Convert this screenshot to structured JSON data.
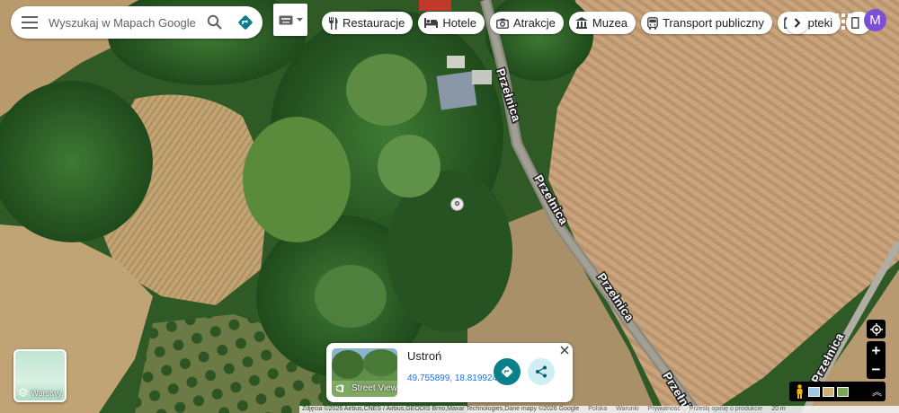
{
  "search": {
    "placeholder": "Wyszukaj w Mapach Google"
  },
  "icons": {
    "menu": "menu-icon",
    "search": "search-icon",
    "directions": "directions-icon",
    "keyboard": "keyboard-icon",
    "apps": "apps-grid-icon",
    "layers": "layers-icon",
    "street_view": "street-view-icon",
    "share": "share-icon",
    "close": "close-icon",
    "locate": "my-location-icon",
    "pegman": "pegman-icon"
  },
  "chips": [
    {
      "label": "Restauracje",
      "icon": "fork-knife-icon"
    },
    {
      "label": "Hotele",
      "icon": "bed-icon"
    },
    {
      "label": "Atrakcje",
      "icon": "camera-icon"
    },
    {
      "label": "Muzea",
      "icon": "museum-icon"
    },
    {
      "label": "Transport publiczny",
      "icon": "bus-icon"
    },
    {
      "label": "Apteki",
      "icon": "pharmacy-icon"
    }
  ],
  "account": {
    "initial": "M"
  },
  "map": {
    "road_labels": [
      "Przełnica",
      "Przełnica",
      "Przełnica",
      "Przełnica",
      "Przełnica"
    ]
  },
  "layers": {
    "label": "Warstwy"
  },
  "place_card": {
    "title": "Ustroń",
    "coordinates": "49.755899, 18.819924",
    "street_view_label": "Street View"
  },
  "controls": {
    "zoom_in": "+",
    "zoom_out": "−"
  },
  "footer": {
    "attribution": "Zdjęcia ©2026 Airbus,CNES / Airbus,GEODIS Brno,Maxar Technologies,Dane mapy ©2026 Google",
    "region": "Polska",
    "terms": "Warunki",
    "privacy": "Prywatność",
    "feedback": "Prześlij opinię o produkcie",
    "scale": "20 m"
  },
  "colors": {
    "accent_teal": "#0b7f8a",
    "avatar": "#7b4fd8",
    "link": "#1a73e8"
  }
}
